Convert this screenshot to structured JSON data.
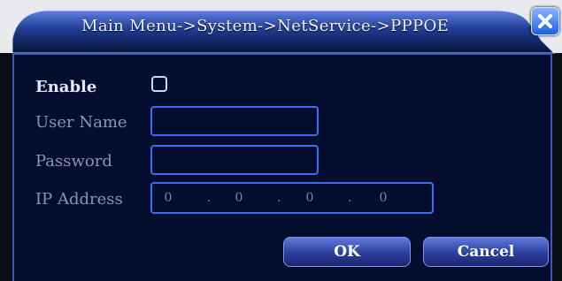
{
  "window": {
    "title": "Main Menu->System->NetService->PPPOE"
  },
  "form": {
    "enable_label": "Enable",
    "enable_checked": false,
    "username_label": "User Name",
    "username_value": "",
    "password_label": "Password",
    "password_value": "",
    "ip_label": "IP Address",
    "ip_octets": [
      "0",
      "0",
      "0",
      "0"
    ],
    "ip_separator": "."
  },
  "buttons": {
    "ok_label": "OK",
    "cancel_label": "Cancel"
  },
  "icons": {
    "close": "close-icon"
  },
  "colors": {
    "panel_bg": "#050d2e",
    "border_accent": "#3b57c4",
    "input_border": "#3f6cf0",
    "close_button": "#2e6de8"
  }
}
